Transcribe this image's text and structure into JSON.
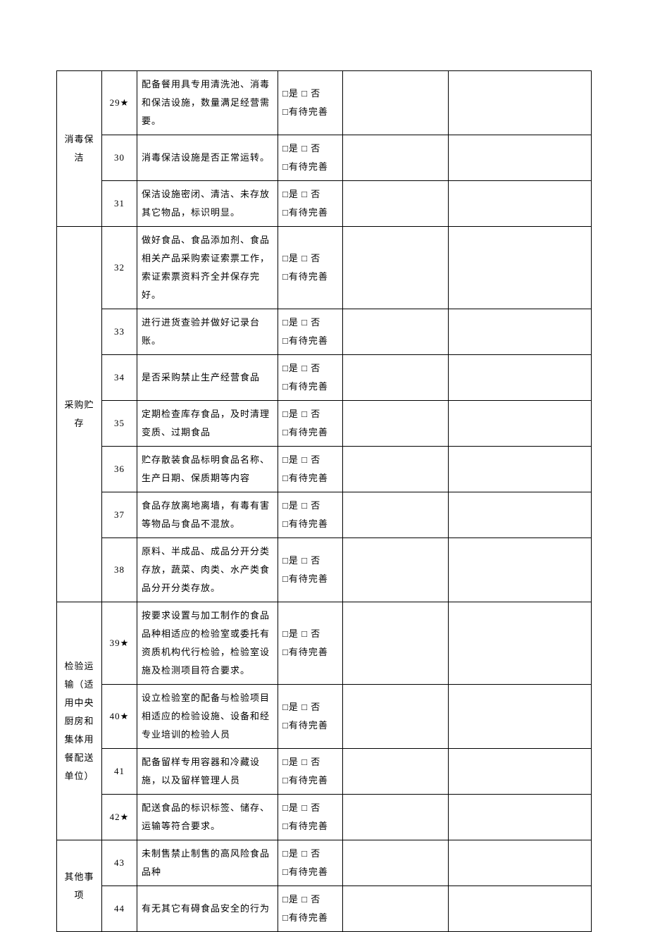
{
  "options": {
    "line1": "□是  □ 否",
    "line2": "□有待完善"
  },
  "categories": [
    {
      "name": "消毒保洁",
      "rows": [
        {
          "num": "29★",
          "desc": "配备餐用具专用清洗池、消毒和保洁设施，数量满足经营需要。"
        },
        {
          "num": "30",
          "desc": "消毒保洁设施是否正常运转。"
        },
        {
          "num": "31",
          "desc": "保洁设施密闭、清洁、未存放其它物品，标识明显。"
        }
      ]
    },
    {
      "name": "采购贮存",
      "rows": [
        {
          "num": "32",
          "desc": "做好食品、食品添加剂、食品相关产品采购索证索票工作，索证索票资料齐全并保存完好。"
        },
        {
          "num": "33",
          "desc": "进行进货查验并做好记录台账。"
        },
        {
          "num": "34",
          "desc": "是否采购禁止生产经营食品"
        },
        {
          "num": "35",
          "desc": "定期检查库存食品，及时清理变质、过期食品"
        },
        {
          "num": "36",
          "desc": "贮存散装食品标明食品名称、生产日期、保质期等内容"
        },
        {
          "num": "37",
          "desc": "食品存放离地离墙，有毒有害等物品与食品不混放。"
        },
        {
          "num": "38",
          "desc": "原料、半成品、成品分开分类存放，蔬菜、肉类、水产类食品分开分类存放。"
        }
      ]
    },
    {
      "name": "检验运输（适用中央厨房和集体用餐配送单位）",
      "rows": [
        {
          "num": "39★",
          "desc": "按要求设置与加工制作的食品品种相适应的检验室或委托有资质机构代行检验，检验室设施及检测项目符合要求。"
        },
        {
          "num": "40★",
          "desc": "设立检验室的配备与检验项目相适应的检验设施、设备和经专业培训的检验人员"
        },
        {
          "num": "41",
          "desc": "配备留样专用容器和冷藏设施，以及留样管理人员"
        },
        {
          "num": "42★",
          "desc": "配送食品的标识标签、储存、运输等符合要求。"
        }
      ]
    },
    {
      "name": "其他事项",
      "rows": [
        {
          "num": "43",
          "desc": "未制售禁止制售的高风险食品品种"
        },
        {
          "num": "44",
          "desc": "有无其它有碍食品安全的行为"
        }
      ]
    }
  ]
}
